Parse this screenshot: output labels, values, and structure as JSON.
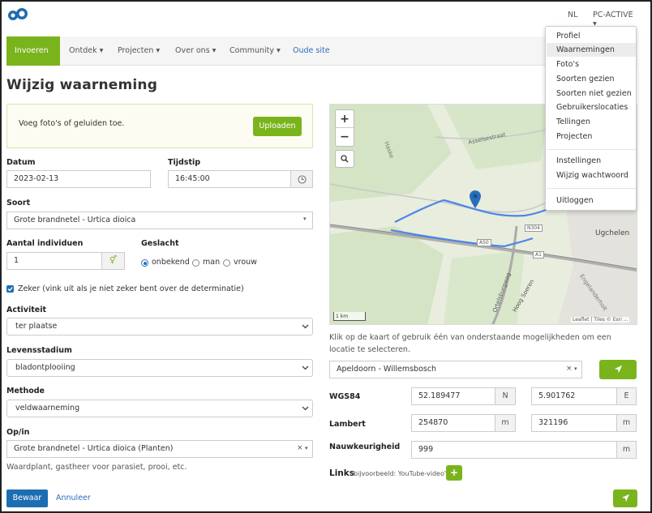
{
  "header": {
    "lang": "NL",
    "user": "PC-ACTIVE ▾"
  },
  "nav": {
    "items": [
      "Invoeren ▾",
      "Ontdek ▾",
      "Projecten ▾",
      "Over ons ▾",
      "Community ▾"
    ],
    "link": "Oude site"
  },
  "dropdown": {
    "items": [
      "Profiel",
      "Waarnemingen",
      "Foto's",
      "Soorten gezien",
      "Soorten niet gezien",
      "Gebruikerslocaties",
      "Tellingen",
      "Projecten"
    ],
    "settings": "Instellingen",
    "password": "Wijzig wachtwoord",
    "logout": "Uitloggen"
  },
  "page": {
    "title": "Wijzig waarneming"
  },
  "upload": {
    "text": "Voeg foto's of geluiden toe.",
    "button": "Uploaden"
  },
  "form": {
    "date_label": "Datum",
    "date_value": "2023-02-13",
    "time_label": "Tijdstip",
    "time_value": "16:45:00",
    "species_label": "Soort",
    "species_value": "Grote brandnetel - Urtica dioica",
    "count_label": "Aantal individuen",
    "count_value": "1",
    "sex_label": "Geslacht",
    "sex_options": [
      "onbekend",
      "man",
      "vrouw"
    ],
    "certain_label": "Zeker (vink uit als je niet zeker bent over de determinatie)",
    "activity_label": "Activiteit",
    "activity_value": "ter plaatse",
    "stage_label": "Levensstadium",
    "stage_value": "bladontplooiing",
    "method_label": "Methode",
    "method_value": "veldwaarneming",
    "on_label": "Op/in",
    "on_value": "Grote brandnetel - Urtica dioica (Planten)",
    "on_help": "Waardplant, gastheer voor parasiet, prooi, etc.",
    "save": "Bewaar",
    "cancel": "Annuleer"
  },
  "map": {
    "labels": [
      "Asselsestraat",
      "Ugchelen",
      "Haske",
      "Engelanderholt",
      "Ortelsburgweg",
      "Hoog Soeren",
      "A50",
      "A1",
      "N304"
    ],
    "scale": "1 km",
    "attribution": "Leaflet | Tiles © Esri ..."
  },
  "location": {
    "help": "Klik op de kaart of gebruik één van onderstaande mogelijkheden om een locatie te selecteren.",
    "place": "Apeldoorn - Willemsbosch",
    "wgs_label": "WGS84",
    "wgs_lat": "52.189477",
    "wgs_lat_unit": "N",
    "wgs_lon": "5.901762",
    "wgs_lon_unit": "E",
    "lambert_label": "Lambert",
    "lambert_x": "254870",
    "lambert_y": "321196",
    "unit_m": "m",
    "accuracy_label": "Nauwkeurigheid",
    "accuracy_value": "999",
    "links_label": "Links",
    "links_help": "bijvoorbeeld: YouTube-video's"
  }
}
